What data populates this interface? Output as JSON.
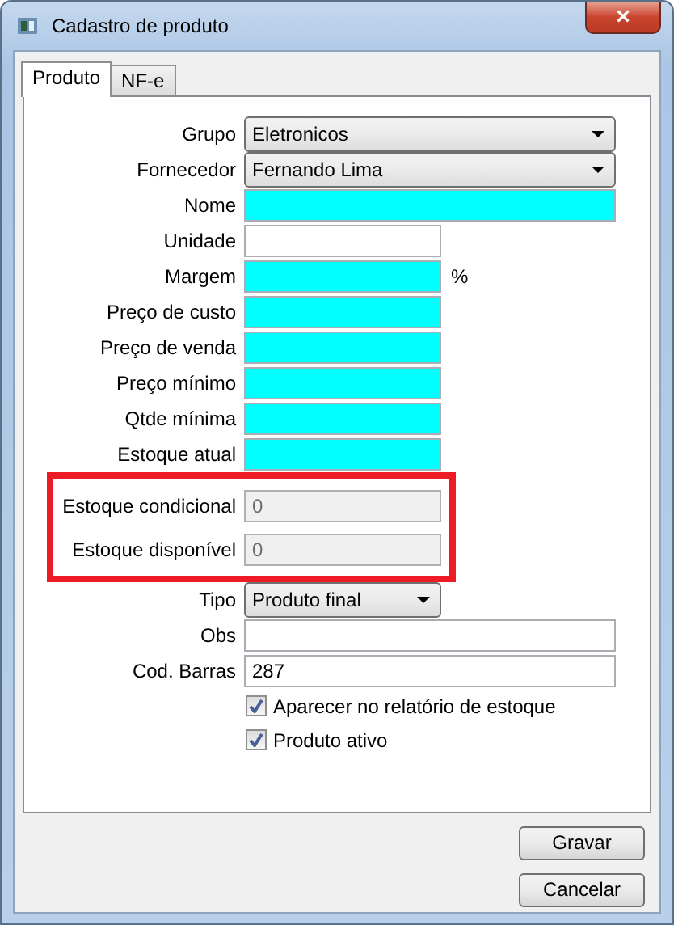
{
  "window": {
    "title": "Cadastro de produto",
    "close": "×"
  },
  "tabs": [
    {
      "label": "Produto",
      "selected": true
    },
    {
      "label": "NF-e",
      "selected": false
    }
  ],
  "fields": [
    {
      "label": "Grupo",
      "kind": "combo",
      "value": "Eletronicos",
      "wide": true,
      "required": false,
      "disabled": false,
      "highlighted": false
    },
    {
      "label": "Fornecedor",
      "kind": "combo",
      "value": "Fernando Lima",
      "wide": true,
      "required": false,
      "disabled": false,
      "highlighted": false
    },
    {
      "label": "Nome",
      "kind": "text",
      "wide": true,
      "required": true,
      "disabled": false,
      "highlighted": false
    },
    {
      "label": "Unidade",
      "kind": "text",
      "wide": false,
      "required": false,
      "disabled": false,
      "highlighted": false
    },
    {
      "label": "Margem",
      "kind": "text",
      "wide": false,
      "required": true,
      "disabled": false,
      "highlighted": false,
      "suffix": "%"
    },
    {
      "label": "Preço de custo",
      "kind": "text",
      "wide": false,
      "required": true,
      "disabled": false,
      "highlighted": false
    },
    {
      "label": "Preço de venda",
      "kind": "text",
      "wide": false,
      "required": true,
      "disabled": false,
      "highlighted": false
    },
    {
      "label": "Preço mínimo",
      "kind": "text",
      "wide": false,
      "required": true,
      "disabled": false,
      "highlighted": false
    },
    {
      "label": "Qtde mínima",
      "kind": "text",
      "wide": false,
      "required": true,
      "disabled": false,
      "highlighted": false
    },
    {
      "label": "Estoque atual",
      "kind": "text",
      "wide": false,
      "required": true,
      "disabled": false,
      "highlighted": false
    },
    {
      "label": "Estoque condicional",
      "kind": "text",
      "value": "0",
      "wide": false,
      "required": false,
      "disabled": true,
      "highlighted": true
    },
    {
      "label": "Estoque disponível",
      "kind": "text",
      "value": "0",
      "wide": false,
      "required": false,
      "disabled": true,
      "highlighted": true
    },
    {
      "label": "Tipo",
      "kind": "combo",
      "value": "Produto final",
      "wide": false,
      "required": false,
      "disabled": false,
      "highlighted": false
    },
    {
      "label": "Obs",
      "kind": "text",
      "wide": true,
      "required": false,
      "disabled": false,
      "highlighted": false
    },
    {
      "label": "Cod. Barras",
      "kind": "text",
      "value": "287",
      "wide": true,
      "required": false,
      "disabled": false,
      "highlighted": false
    }
  ],
  "checkboxes": [
    {
      "label": "Aparecer no relatório de estoque",
      "checked": true
    },
    {
      "label": "Produto ativo",
      "checked": true
    }
  ],
  "buttons": [
    "Gravar",
    "Cancelar"
  ]
}
